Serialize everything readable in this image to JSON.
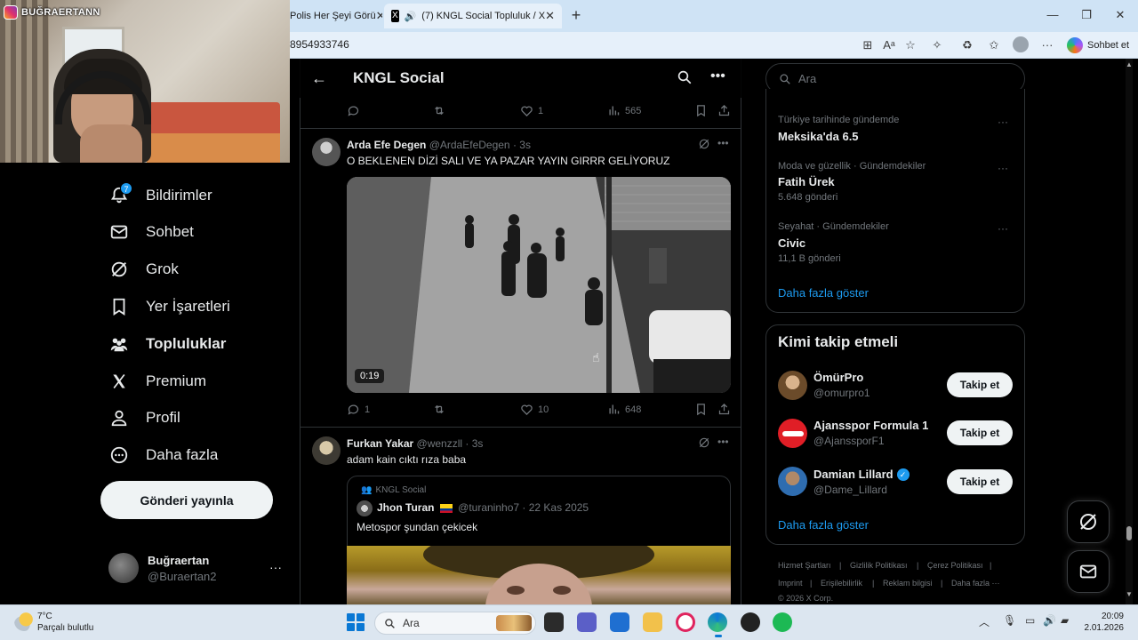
{
  "browser": {
    "tabs": [
      {
        "label": "Polis Her Şeyi Görü"
      },
      {
        "label": "(7) KNGL Social Topluluk / X"
      }
    ],
    "url": "8954933746",
    "copilot_label": "Sohbet et"
  },
  "webcam": {
    "badge": "BUĞRAERTANN"
  },
  "nav": {
    "items": [
      {
        "label": "Bildirimler",
        "icon": "bell-icon",
        "badge": "7"
      },
      {
        "label": "Sohbet",
        "icon": "mail-icon"
      },
      {
        "label": "Grok",
        "icon": "grok-icon"
      },
      {
        "label": "Yer İşaretleri",
        "icon": "bookmark-icon"
      },
      {
        "label": "Topluluklar",
        "icon": "communities-icon"
      },
      {
        "label": "Premium",
        "icon": "x-logo-icon"
      },
      {
        "label": "Profil",
        "icon": "person-icon"
      },
      {
        "label": "Daha fazla",
        "icon": "more-circle-icon"
      }
    ],
    "post_button": "Gönderi yayınla",
    "profile": {
      "name": "Buğraertan",
      "handle": "@Buraertan2",
      "more": "···"
    }
  },
  "feed": {
    "title": "KNGL Social",
    "top_actions": {
      "likes": "1",
      "views": "565"
    },
    "tweets": [
      {
        "name": "Arda Efe Degen",
        "handle": "@ArdaEfeDegen",
        "time": "· 3s",
        "text": "O BEKLENEN DİZİ SALI VE YA PAZAR YAYIN GIRRR GELİYORUZ",
        "video_duration": "0:19",
        "replies": "1",
        "likes": "10",
        "views": "648"
      },
      {
        "name": "Furkan Yakar",
        "handle": "@wenzzll",
        "time": "· 3s",
        "text": "adam kain cıktı rıza baba",
        "quote": {
          "community": "KNGL Social",
          "name": "Jhon Turan",
          "handle": "@turaninho7",
          "time": "· 22 Kas 2025",
          "text": "Metospor şundan çekicek"
        }
      }
    ]
  },
  "sidebar": {
    "search_placeholder": "Ara",
    "trends": [
      {
        "meta": "Türkiye tarihinde gündemde",
        "title": "Meksika'da 6.5",
        "count": ""
      },
      {
        "meta": "Moda ve güzellik · Gündemdekiler",
        "title": "Fatih Ürek",
        "count": "5.648 gönderi"
      },
      {
        "meta": "Seyahat · Gündemdekiler",
        "title": "Civic",
        "count": "11,1 B gönderi"
      }
    ],
    "show_more": "Daha fazla göster",
    "who_to_follow": {
      "title": "Kimi takip etmeli",
      "follow_label": "Takip et",
      "users": [
        {
          "name": "ÖmürPro",
          "handle": "@omurpro1",
          "verified": false
        },
        {
          "name": "Ajansspor Formula 1",
          "handle": "@AjanssporF1",
          "verified": false
        },
        {
          "name": "Damian Lillard",
          "handle": "@Dame_Lillard",
          "verified": true
        }
      ],
      "show_more": "Daha fazla göster"
    },
    "footer": {
      "links": [
        "Hizmet Şartları",
        "Gizlilik Politikası",
        "Çerez Politikası",
        "Imprint",
        "Erişilebilirlik",
        "Reklam bilgisi",
        "Daha fazla ···"
      ],
      "copyright": "© 2026 X Corp."
    }
  },
  "taskbar": {
    "weather_temp": "7°C",
    "weather_desc": "Parçalı bulutlu",
    "search_label": "Ara",
    "time": "20:09",
    "date": "2.01.2026"
  },
  "colors": {
    "accent": "#1d9bf0",
    "background": "#000000",
    "text": "#e7e9ea",
    "muted": "#71767b",
    "border": "#2f3336"
  }
}
